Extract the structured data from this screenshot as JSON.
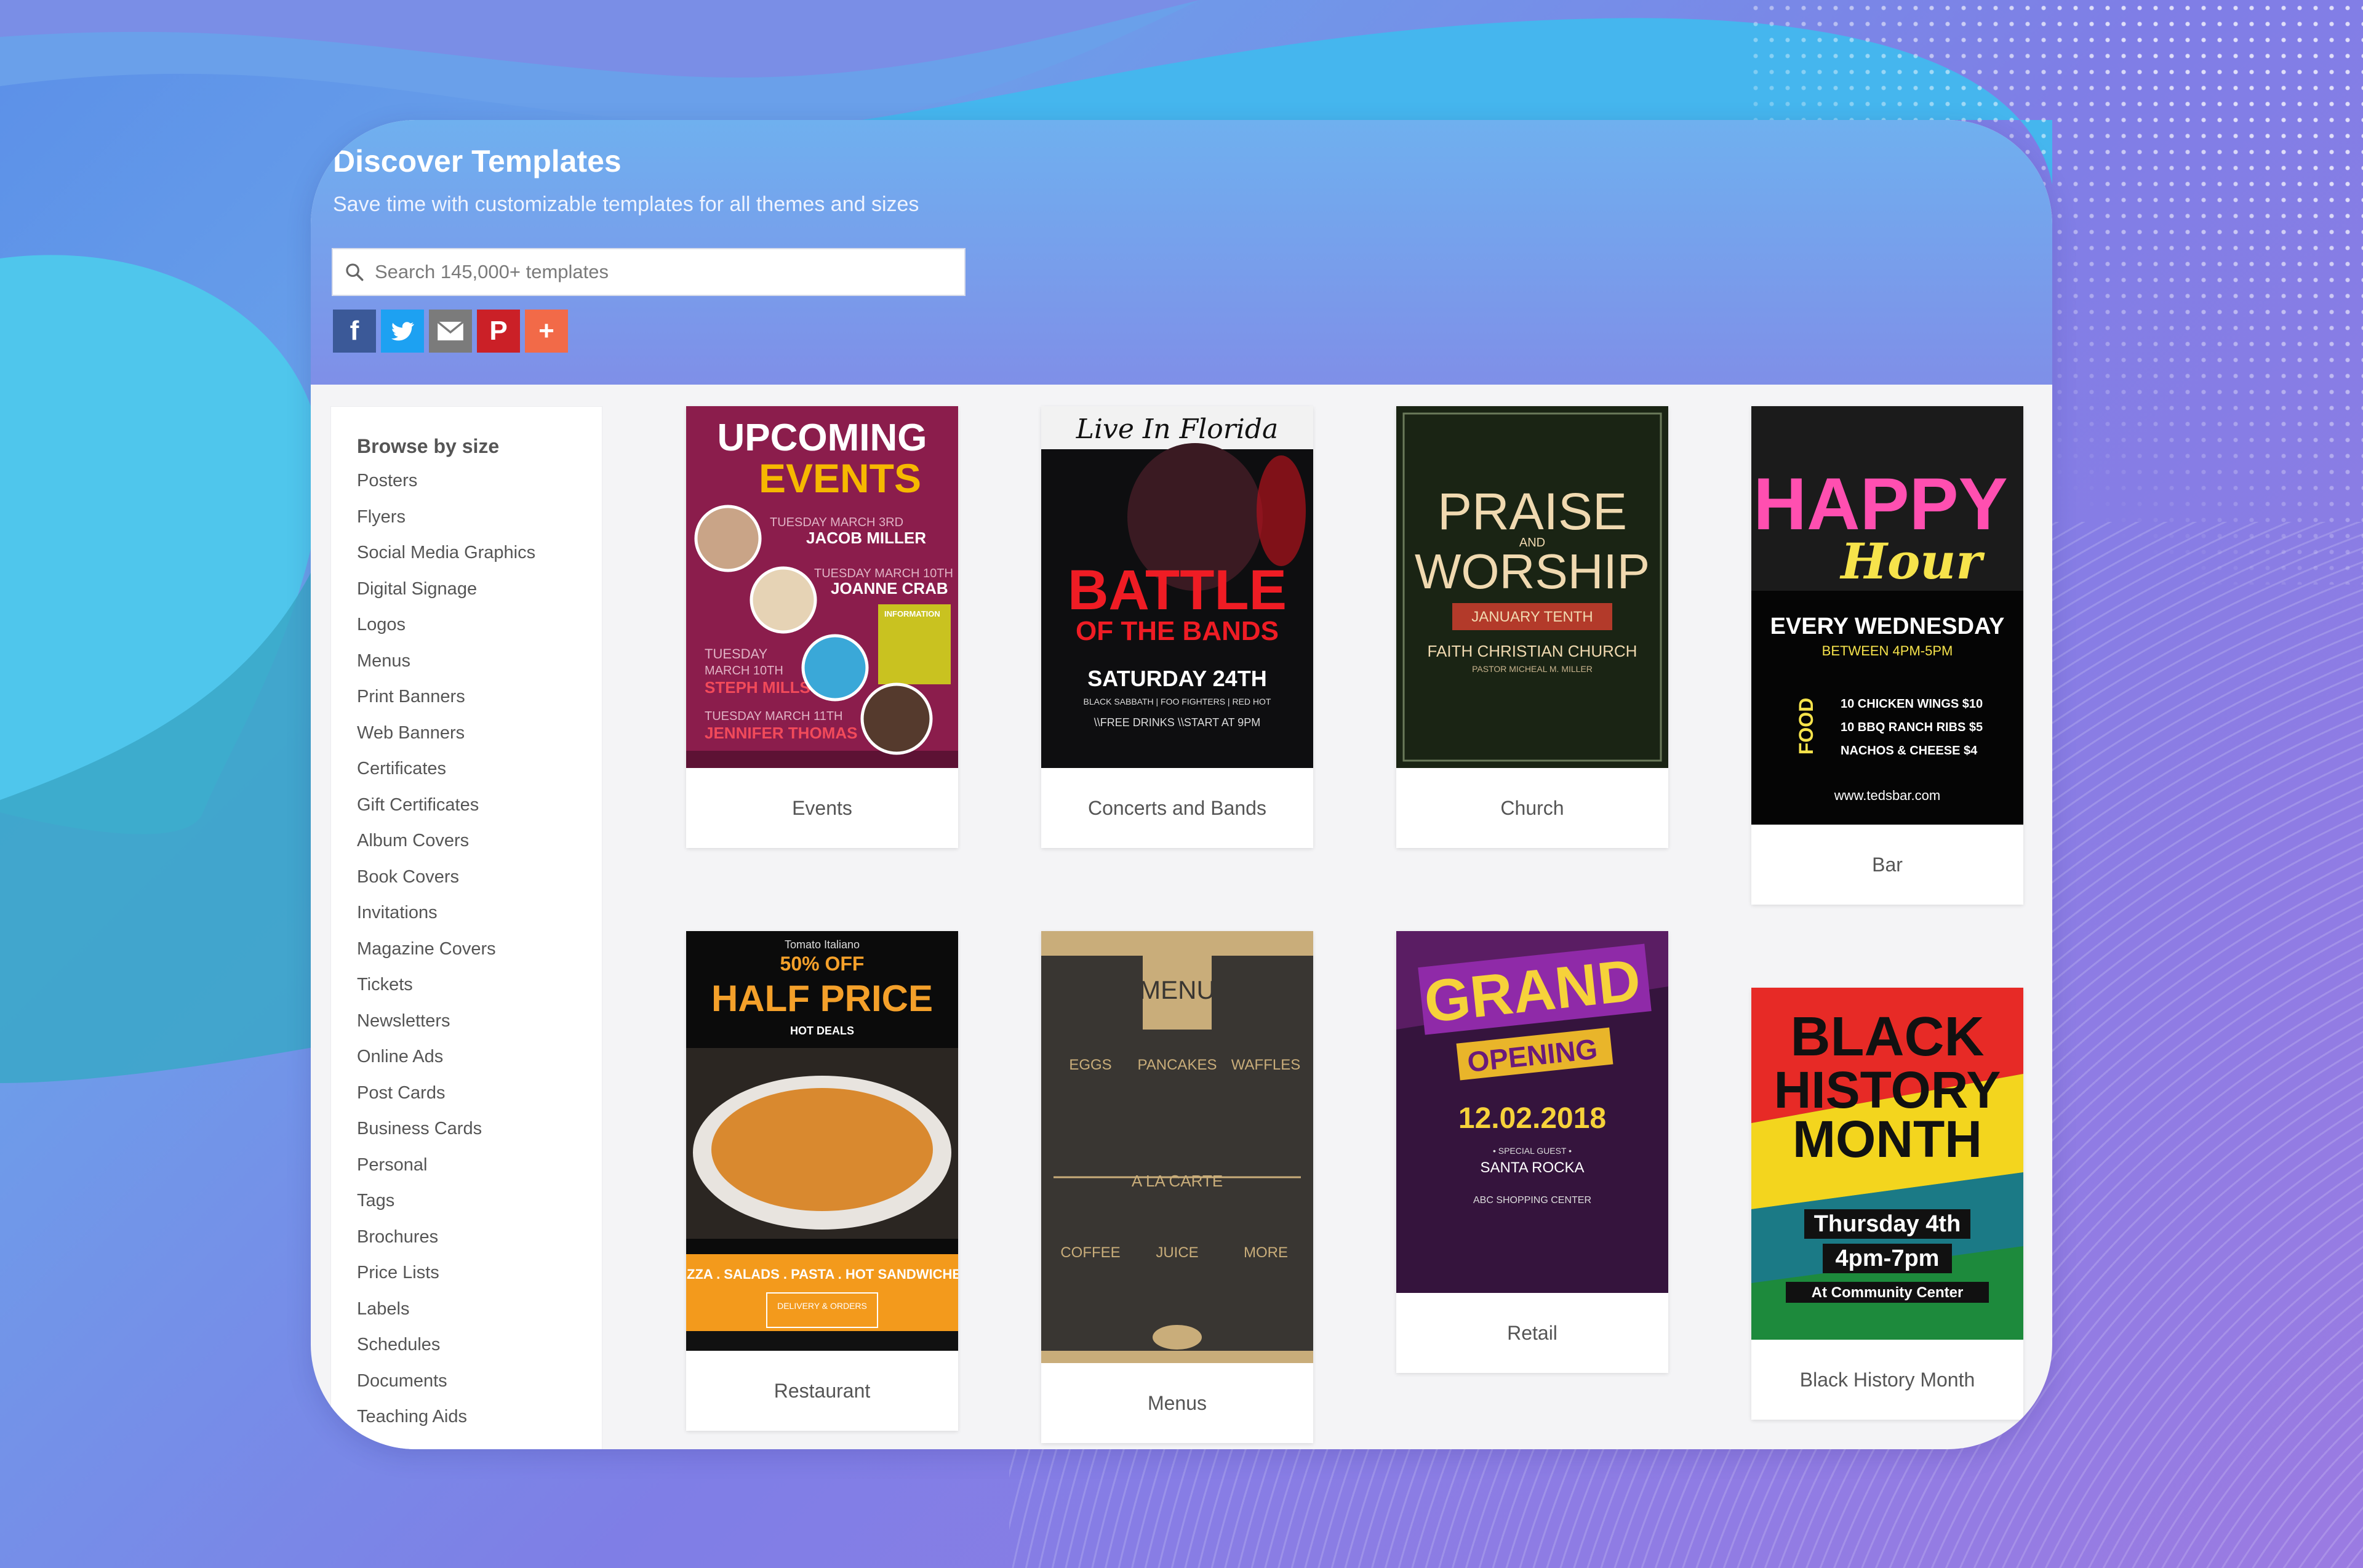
{
  "header": {
    "title": "Discover Templates",
    "subtitle": "Save time with customizable templates for all themes and sizes"
  },
  "search": {
    "placeholder": "Search 145,000+ templates",
    "icon": "search-icon"
  },
  "share": [
    {
      "name": "facebook",
      "glyph": "f",
      "color": "#3b5998"
    },
    {
      "name": "twitter",
      "glyph": "t",
      "color": "#1da1f2"
    },
    {
      "name": "email",
      "glyph": "✉",
      "color": "#777777"
    },
    {
      "name": "pinterest",
      "glyph": "P",
      "color": "#cb2027"
    },
    {
      "name": "more",
      "glyph": "+",
      "color": "#f26a48"
    }
  ],
  "sidebar": {
    "heading": "Browse by size",
    "items": [
      "Posters",
      "Flyers",
      "Social Media Graphics",
      "Digital Signage",
      "Logos",
      "Menus",
      "Print Banners",
      "Web Banners",
      "Certificates",
      "Gift Certificates",
      "Album Covers",
      "Book Covers",
      "Invitations",
      "Magazine Covers",
      "Tickets",
      "Newsletters",
      "Online Ads",
      "Post Cards",
      "Business Cards",
      "Personal",
      "Tags",
      "Brochures",
      "Price Lists",
      "Labels",
      "Schedules",
      "Documents",
      "Teaching Aids"
    ]
  },
  "templates": [
    {
      "label": "Events",
      "poster": {
        "lines": [
          "UPCOMING",
          "EVENTS",
          "TUESDAY MARCH 3RD",
          "JACOB MILLER",
          "TUESDAY MARCH 10TH",
          "JOANNE CRAB",
          "INFORMATION",
          "TUESDAY",
          "MARCH 10TH",
          "STEPH MILLS",
          "TUESDAY MARCH 11TH",
          "JENNIFER THOMAS"
        ]
      }
    },
    {
      "label": "Concerts and Bands",
      "poster": {
        "lines": [
          "Live In Florida",
          "BATTLE",
          "OF THE BANDS",
          "SATURDAY 24TH",
          "BLACK SABBATH | FOO FIGHTERS | RED HOT",
          "\\\\FREE DRINKS \\\\START AT 9PM"
        ]
      }
    },
    {
      "label": "Church",
      "poster": {
        "lines": [
          "PRAISE",
          "AND",
          "WORSHIP",
          "JANUARY TENTH",
          "FAITH CHRISTIAN CHURCH",
          "PASTOR MICHEAL M. MILLER"
        ]
      }
    },
    {
      "label": "Bar",
      "poster": {
        "lines": [
          "HAPPY",
          "Hour",
          "EVERY WEDNESDAY",
          "BETWEEN 4PM-5PM",
          "FOOD",
          "10 CHICKEN WINGS $10",
          "10 BBQ RANCH RIBS $5",
          "NACHOS & CHEESE $4",
          "www.tedsbar.com"
        ]
      }
    },
    {
      "label": "Restaurant",
      "poster": {
        "lines": [
          "Tomato Italiano",
          "50% OFF",
          "HALF PRICE",
          "HOT DEALS",
          "PIZZA . SALADS . PASTA . HOT SANDWICHES",
          "DELIVERY & ORDERS"
        ]
      }
    },
    {
      "label": "Menus",
      "poster": {
        "lines": [
          "MENU",
          "EGGS",
          "PANCAKES",
          "WAFFLES",
          "A LA CARTE",
          "COFFEE",
          "JUICE",
          "MORE"
        ]
      }
    },
    {
      "label": "Retail",
      "poster": {
        "lines": [
          "GRAND",
          "OPENING",
          "12.02.2018",
          "• SPECIAL GUEST •",
          "SANTA ROCKA",
          "ABC SHOPPING CENTER"
        ]
      }
    },
    {
      "label": "Black History Month",
      "poster": {
        "lines": [
          "BLACK",
          "HISTORY",
          "MONTH",
          "Thursday 4th",
          "4pm-7pm",
          "At Community Center"
        ]
      }
    }
  ]
}
